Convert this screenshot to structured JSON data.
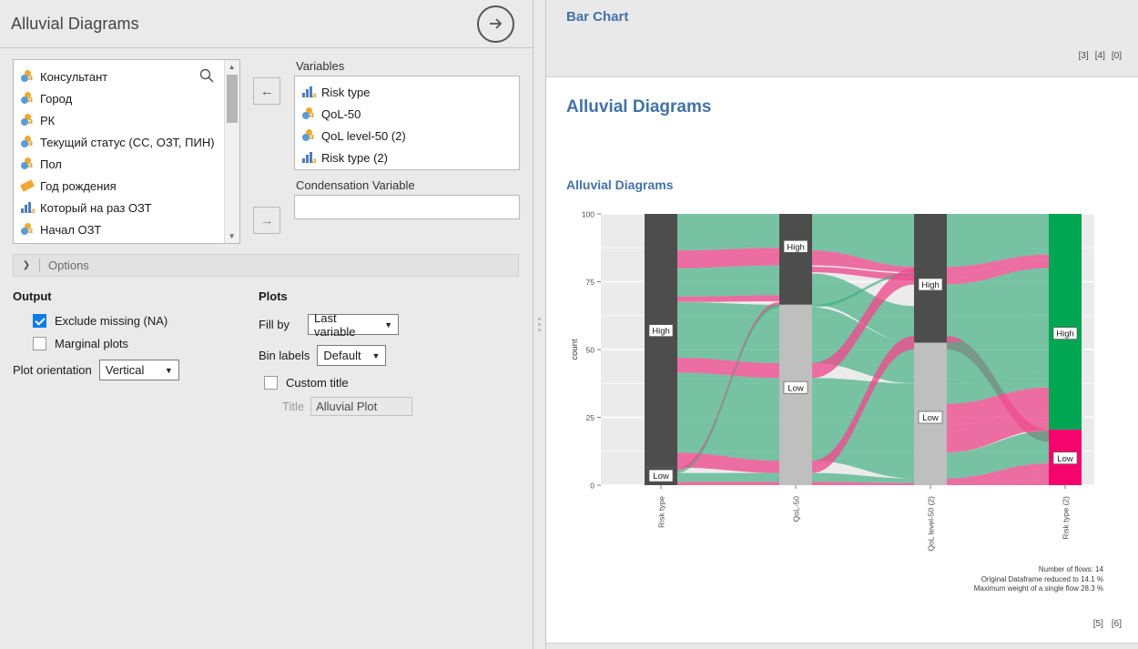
{
  "left_panel": {
    "title": "Alluvial Diagrams",
    "go_button": "go-arrow",
    "source_list": {
      "items": [
        {
          "label": "Консультант",
          "type": "nominal"
        },
        {
          "label": "Город",
          "type": "nominal"
        },
        {
          "label": "РК",
          "type": "nominal"
        },
        {
          "label": "Текущий статус (СС, ОЗТ, ПИН)",
          "type": "nominal"
        },
        {
          "label": "Пол",
          "type": "nominal"
        },
        {
          "label": "Год рождения",
          "type": "continuous"
        },
        {
          "label": "Который на раз ОЗТ",
          "type": "ordinal"
        },
        {
          "label": "Начал ОЗТ",
          "type": "nominal"
        }
      ]
    },
    "variables": {
      "label": "Variables",
      "items": [
        {
          "label": "Risk type",
          "type": "ordinal"
        },
        {
          "label": "QoL-50",
          "type": "nominal"
        },
        {
          "label": "QoL level-50 (2)",
          "type": "nominal"
        },
        {
          "label": "Risk type (2)",
          "type": "ordinal"
        }
      ]
    },
    "condensation": {
      "label": "Condensation Variable",
      "value": ""
    },
    "options_bar": {
      "label": "Options",
      "expanded": true
    },
    "output": {
      "heading": "Output",
      "exclude_missing": {
        "label": "Exclude missing (NA)",
        "checked": true
      },
      "marginal_plots": {
        "label": "Marginal plots",
        "checked": false
      },
      "plot_orientation": {
        "label": "Plot orientation",
        "value": "Vertical"
      }
    },
    "plots": {
      "heading": "Plots",
      "fill_by": {
        "label": "Fill by",
        "value": "Last variable"
      },
      "bin_labels": {
        "label": "Bin labels",
        "value": "Default"
      },
      "custom_title": {
        "label": "Custom title",
        "checked": false
      },
      "title": {
        "label": "Title",
        "value": "Alluvial Plot"
      }
    }
  },
  "right_panel": {
    "header_title": "Bar Chart",
    "header_refs": [
      "[3]",
      "[4]",
      "[0]"
    ],
    "page_title": "Alluvial Diagrams",
    "section_title": "Alluvial Diagrams",
    "footer_refs": [
      "[5]",
      "[6]"
    ],
    "notes": [
      "Number of flows: 14",
      "Original Dataframe reduced to 14.1 %",
      "Maximum weight of a single flow 28.3 %"
    ]
  },
  "chart_data": {
    "type": "alluvial",
    "title": "Alluvial Diagrams",
    "ylabel": "count",
    "ylim": [
      0,
      100
    ],
    "yticks": [
      0,
      25,
      50,
      75,
      100
    ],
    "grid": true,
    "axes": [
      "Risk type",
      "QoL-50",
      "QoL level-50 (2)",
      "Risk type (2)"
    ],
    "colors": {
      "stratum_dark": "#4d4d4d",
      "stratum_light": "#bfbfbf",
      "fill_high": "#00a651",
      "fill_low": "#f5056b",
      "flow_high": "#3fae7f",
      "flow_low": "#ec4d8f"
    },
    "strata": [
      {
        "axis": "Risk type",
        "blocks": [
          {
            "label": "High",
            "from": 6.5,
            "to": 100,
            "color": "#4d4d4d"
          },
          {
            "label": "Low",
            "from": 0,
            "to": 6.5,
            "color": "#4d4d4d"
          }
        ]
      },
      {
        "axis": "QoL-50",
        "blocks": [
          {
            "label": "High",
            "from": 66.5,
            "to": 100,
            "color": "#4d4d4d"
          },
          {
            "label": "Low",
            "from": 0,
            "to": 66.5,
            "color": "#bfbfbf"
          }
        ]
      },
      {
        "axis": "QoL level-50 (2)",
        "blocks": [
          {
            "label": "High",
            "from": 52.5,
            "to": 100,
            "color": "#4d4d4d"
          },
          {
            "label": "Low",
            "from": 0,
            "to": 52.5,
            "color": "#bfbfbf"
          }
        ]
      },
      {
        "axis": "Risk type (2)",
        "blocks": [
          {
            "label": "High",
            "from": 20.5,
            "to": 100,
            "color": "#00a651"
          },
          {
            "label": "Low",
            "from": 0,
            "to": 20.5,
            "color": "#f5056b"
          }
        ]
      }
    ],
    "flow_labels": {
      "high": "High",
      "low": "Low"
    }
  }
}
